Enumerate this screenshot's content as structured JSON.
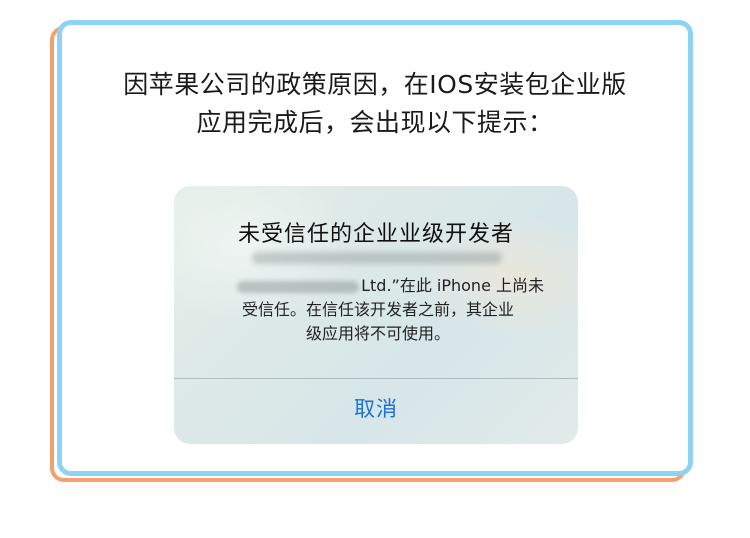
{
  "instructions": {
    "line1": "因苹果公司的政策原因，在IOS安装包企业版",
    "line2": "应用完成后，会出现以下提示："
  },
  "alert": {
    "title": "未受信任的企业业级开发者",
    "message_line1_tail": "Ltd.”在此 iPhone 上尚未",
    "message_line2": "受信任。在信任该开发者之前，其企业",
    "message_line3": "级应用将不可使用。",
    "cancel_label": "取消"
  },
  "colors": {
    "frame_blue": "#8fd3f2",
    "frame_orange": "#f4a06e",
    "button_blue": "#1d6fd6"
  }
}
